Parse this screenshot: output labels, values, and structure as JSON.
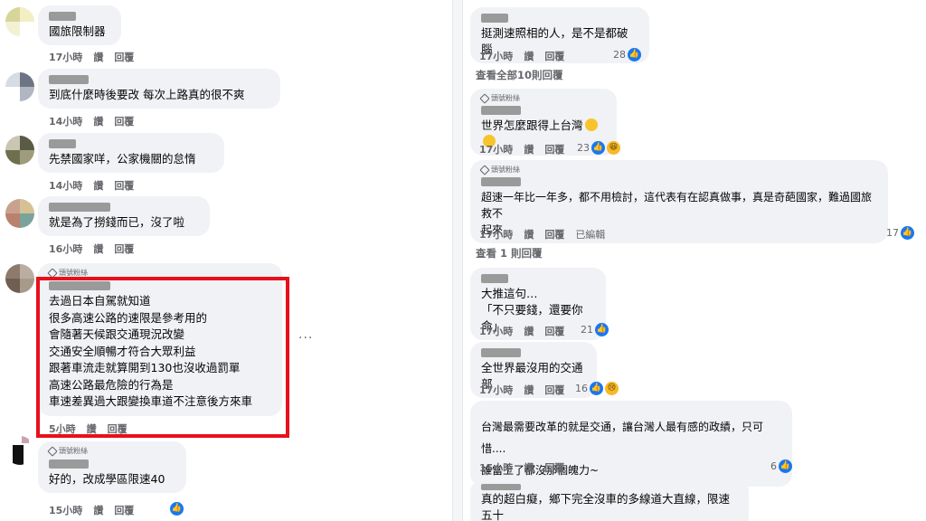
{
  "left": {
    "comments": [
      {
        "text": "國旅限制器",
        "time": "17小時",
        "like": "讚",
        "reply": "回覆"
      },
      {
        "text": "到底什麼時後要改 每次上路真的很不爽",
        "time": "14小時",
        "like": "讚",
        "reply": "回覆"
      },
      {
        "text": "先禁國家咩，公家機關的怠惰",
        "time": "14小時",
        "like": "讚",
        "reply": "回覆"
      },
      {
        "text": "就是為了撈錢而已，沒了啦",
        "time": "16小時",
        "like": "讚",
        "reply": "回覆"
      },
      {
        "badge": "頭號粉絲",
        "lines": [
          "去過日本自駕就知道",
          "很多高速公路的速限是參考用的",
          "會隨著天候跟交通現況改變",
          "交通安全順暢才符合大眾利益",
          "跟著車流走就算開到130也沒收過罰單",
          "高速公路最危險的行為是",
          "車速差異過大跟變換車道不注意後方來車"
        ],
        "time": "5小時",
        "like": "讚",
        "reply": "回覆",
        "more": "···"
      },
      {
        "badge": "頭號粉絲",
        "text": "好的，改成學區限速40",
        "time": "15小時",
        "like": "讚",
        "reply": "回覆"
      }
    ]
  },
  "right": {
    "c1": {
      "text": "挺測速照相的人，是不是都破腦",
      "time": "17小時",
      "like": "讚",
      "reply": "回覆",
      "count": "28"
    },
    "view_all": "查看全部10則回覆",
    "c2": {
      "badge": "頭號粉絲",
      "text": "世界怎麼跟得上台灣",
      "time": "17小時",
      "like": "讚",
      "reply": "回覆",
      "count": "23"
    },
    "c3": {
      "badge": "頭號粉絲",
      "lines": [
        "超速一年比一年多，都不用檢討，這代表有在認真做事，真是奇葩國家，難過國旅救不",
        "起來"
      ],
      "time": "17小時",
      "like": "讚",
      "reply": "回覆",
      "edited": "已編輯",
      "count": "17"
    },
    "view_one": "查看 1 則回覆",
    "c4": {
      "lines": [
        "大推這句…",
        "「不只要錢，還要你命」"
      ],
      "time": "17小時",
      "like": "讚",
      "reply": "回覆",
      "count": "21"
    },
    "c5": {
      "text": "全世界最沒用的交通部",
      "time": "17小時",
      "like": "讚",
      "reply": "回覆",
      "count": "16"
    },
    "c6": {
      "lines": [
        "台灣最需要改革的就是交通，讓台灣人最有感的政績，只可惜....",
        "誰當上了都沒那個魄力~"
      ],
      "time": "15小時",
      "like": "讚",
      "reply": "回覆",
      "count": "6"
    },
    "c7": {
      "text": "真的超白癡，鄉下完全沒車的多線道大直線，限速五十"
    }
  },
  "colors": {
    "highlight": "#e8101a",
    "like": "#1877f2",
    "bubble": "#f0f2f5",
    "meta": "#65676b"
  }
}
